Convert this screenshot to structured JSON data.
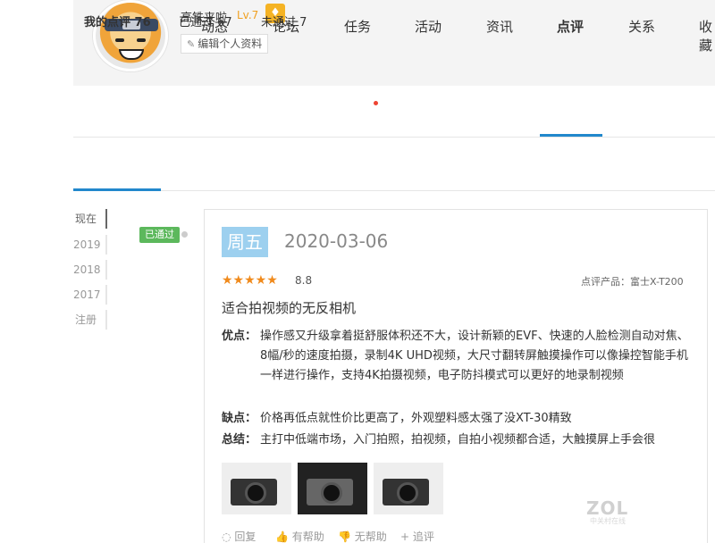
{
  "profile": {
    "username": "高铁来啦",
    "level": "Lv.7",
    "edit_label": "编辑个人资料"
  },
  "nav": {
    "items": [
      "动态",
      "论坛",
      "任务",
      "活动",
      "资讯",
      "点评",
      "关系",
      "收藏"
    ],
    "active": "点评"
  },
  "subtabs": {
    "my_reviews": "我的点评",
    "my_reviews_count": "76",
    "passed": "已通过 67",
    "not_passed": "未通过 7"
  },
  "timeline": [
    "现在",
    "2019",
    "2018",
    "2017",
    "注册"
  ],
  "review": {
    "status": "已通过",
    "weekday": "周五",
    "date": "2020-03-06",
    "stars": "★★★★★",
    "score": "8.8",
    "product": "点评产品：富士X-T200",
    "title": "适合拍视频的无反相机",
    "pros_label": "优点：",
    "pros": "操作感又升级拿着挺舒服体积还不大，设计新颖的EVF、快速的人脸检测自动对焦、8幅/秒的速度拍摄，录制4K UHD视频，大尺寸翻转屏触摸操作可以像操控智能手机一样进行操作，支持4K拍摄视频，电子防抖模式可以更好的地录制视频",
    "cons_label": "缺点：",
    "cons": "价格再低点就性价比更高了，外观塑料感太强了没XT-30精致",
    "summary_label": "总结：",
    "summary": "主打中低端市场，入门拍照，拍视频，自拍小视频都合适，大触摸屏上手会很"
  },
  "actions": {
    "reply": "回复",
    "helpful": "有帮助",
    "unhelpful": "无帮助",
    "follow_up": "追评"
  },
  "watermark": {
    "logo": "ZOL",
    "sub": "中关村在线"
  },
  "colors": {
    "accent": "#2288cc",
    "passed_badge": "#5cb85c",
    "star": "#f08a1c",
    "weekday_bg": "#9dd0ef"
  }
}
